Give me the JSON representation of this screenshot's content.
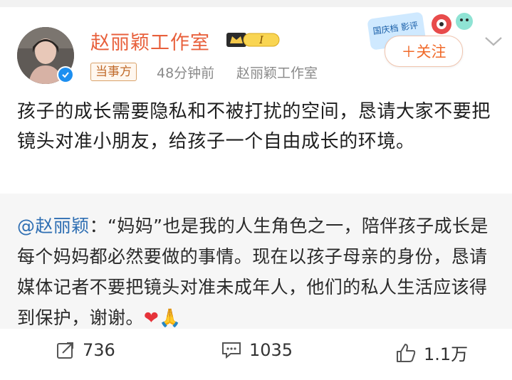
{
  "post": {
    "author": "赵丽颖工作室",
    "vip_level": "I",
    "tag": "当事方",
    "time": "48分钟前",
    "source": "赵丽颖工作室",
    "follow_label": "＋关注",
    "badge_text": "国庆档 影评",
    "text": "孩子的成长需要隐私和不被打扰的空间，恳请大家不要把镜头对准小朋友，给孩子一个自由成长的环境。"
  },
  "repost": {
    "mention": "@赵丽颖",
    "text": "：“妈妈”也是我的人生角色之一，陪伴孩子成长是每个妈妈都必然要做的事情。现在以孩子母亲的身份，恳请媒体记者不要把镜头对准未成年人，他们的私人生活应该得到保护，谢谢。",
    "emojis": "❤🙏"
  },
  "actions": {
    "repost_count": "736",
    "comment_count": "1035",
    "like_count": "1.1万"
  },
  "colors": {
    "accent": "#e8603c",
    "mention": "#2f6fb3",
    "follow": "#f06a2a"
  }
}
